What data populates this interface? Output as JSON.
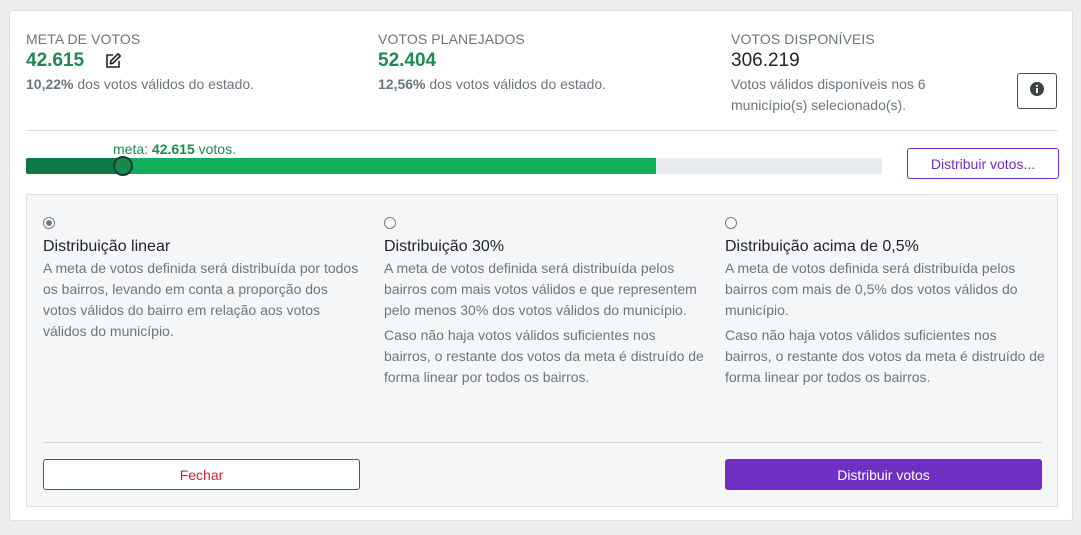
{
  "stats": {
    "meta": {
      "label": "META DE VOTOS",
      "value": "42.615",
      "desc_pct": "10,22%",
      "desc_text": " dos votos válidos do estado."
    },
    "planejados": {
      "label": "VOTOS PLANEJADOS",
      "value": "52.404",
      "desc_pct": "12,56%",
      "desc_text": " dos votos válidos do estado."
    },
    "disponiveis": {
      "label": "VOTOS DISPONÍVEIS",
      "value": "306.219",
      "desc_line1": "Votos válidos disponíveis nos 6",
      "desc_line2": "município(s) selecionado(s)."
    }
  },
  "progress": {
    "meta_prefix": "meta: ",
    "meta_value": "42.615",
    "meta_suffix": " votos.",
    "meta_fraction": 0.112,
    "planned_fraction": 0.736
  },
  "distribute_button_label": "Distribuir votos...",
  "options": [
    {
      "checked": true,
      "title": "Distribuição linear",
      "text": "A meta de votos definida será distribuída por todos os bairros, levando em conta a proporção dos votos válidos do bairro em relação aos votos válidos do município.",
      "note": ""
    },
    {
      "checked": false,
      "title": "Distribuição 30%",
      "text": "A meta de votos definida será distribuída pelos bairros com mais votos válidos e que representem pelo menos 30% dos votos válidos do município.",
      "note": "Caso não haja votos válidos suficientes nos bairros, o restante dos votos da meta é distruído de forma linear por todos os bairros."
    },
    {
      "checked": false,
      "title": "Distribuição acima de 0,5%",
      "text": "A meta de votos definida será distribuída pelos bairros com mais de 0,5% dos votos válidos do município.",
      "note": "Caso não haja votos válidos suficientes nos bairros, o restante dos votos da meta é distruído de forma linear por todos os bairros."
    }
  ],
  "buttons": {
    "close": "Fechar",
    "distribute": "Distribuir votos"
  },
  "colors": {
    "accent_green": "#1e8a52",
    "progress_green": "#12b05c",
    "progress_dark_green": "#0e7a43",
    "purple": "#6f2fc2",
    "danger": "#d0213a"
  }
}
